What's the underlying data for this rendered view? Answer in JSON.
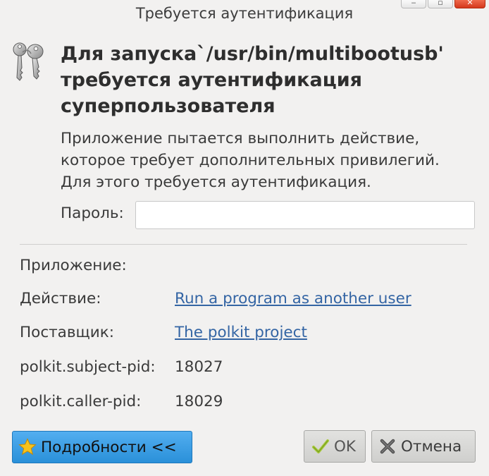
{
  "window": {
    "title": "Требуется аутентификация",
    "controls": {
      "minimize": "‒",
      "maximize": "▫",
      "close": "✕"
    }
  },
  "icons": {
    "header": "keys-icon",
    "details": "star-icon",
    "ok": "checkmark-icon",
    "cancel": "x-icon"
  },
  "heading": {
    "line1": "Для запуска`/usr/bin/multibootusb'",
    "line2": "требуется аутентификация",
    "line3": "суперпользователя"
  },
  "description": {
    "line1": "Приложение пытается выполнить действие,",
    "line2": "которое требует дополнительных привилегий.",
    "line3": "Для этого требуется аутентификация."
  },
  "password": {
    "label": "Пароль:",
    "value": "",
    "placeholder": ""
  },
  "details": {
    "application_label": "Приложение:",
    "action_label": "Действие:",
    "action_value": "Run a program as another user",
    "vendor_label": "Поставщик:",
    "vendor_value": "The polkit project",
    "subject_pid_label": "polkit.subject-pid:",
    "subject_pid_value": "18027",
    "caller_pid_label": "polkit.caller-pid:",
    "caller_pid_value": "18029"
  },
  "buttons": {
    "details": "Подробности <<",
    "ok": "OK",
    "cancel": "Отмена"
  },
  "colors": {
    "background": "#f2f1f0",
    "link": "#3465a4",
    "details_button": "#2a90d9",
    "close_button": "#d4381c"
  }
}
